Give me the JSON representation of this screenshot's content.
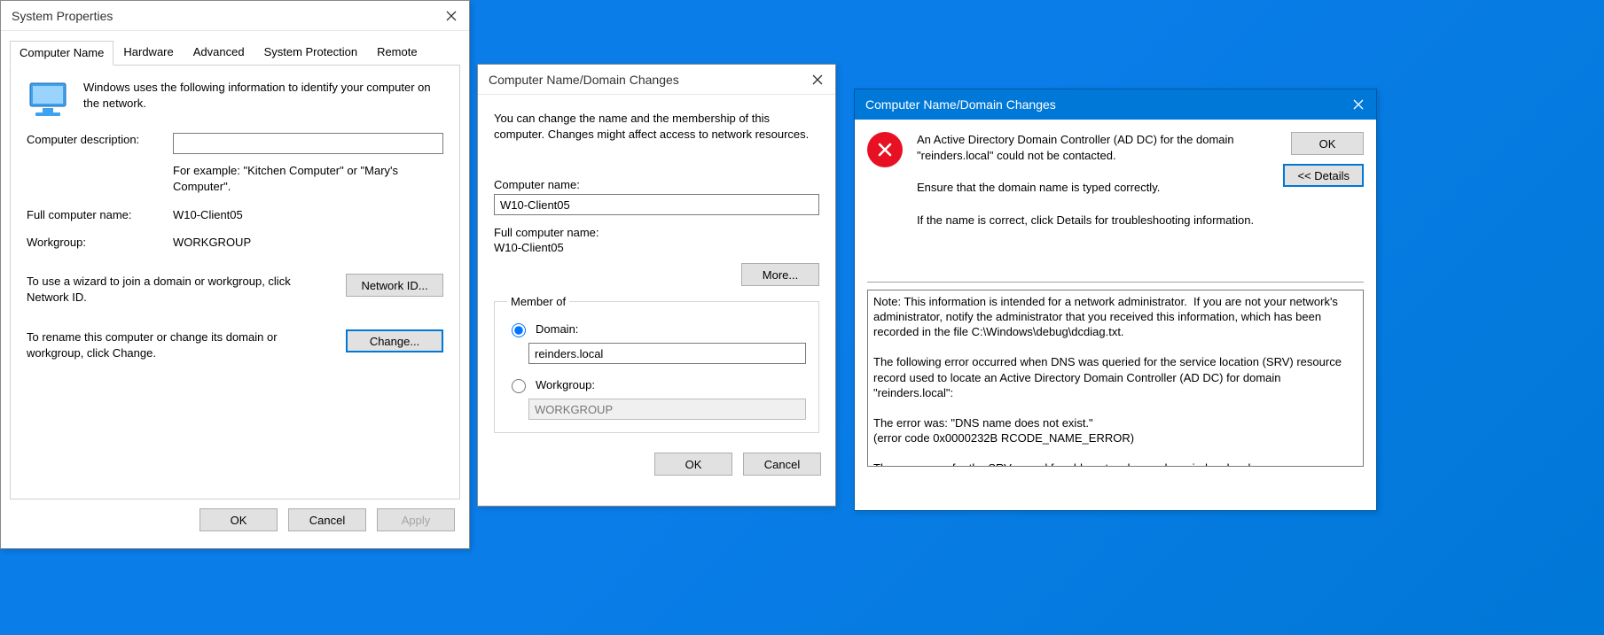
{
  "sysprops": {
    "title": "System Properties",
    "tabs": [
      "Computer Name",
      "Hardware",
      "Advanced",
      "System Protection",
      "Remote"
    ],
    "active_tab": 0,
    "intro": "Windows uses the following information to identify your computer on the network.",
    "desc_label": "Computer description:",
    "desc_value": "",
    "desc_example": "For example: \"Kitchen Computer\" or \"Mary's Computer\".",
    "full_name_label": "Full computer name:",
    "full_name_value": "W10-Client05",
    "workgroup_label": "Workgroup:",
    "workgroup_value": "WORKGROUP",
    "wizard_text": "To use a wizard to join a domain or workgroup, click Network ID.",
    "network_id_btn": "Network ID...",
    "change_text": "To rename this computer or change its domain or workgroup, click Change.",
    "change_btn": "Change...",
    "ok_btn": "OK",
    "cancel_btn": "Cancel",
    "apply_btn": "Apply"
  },
  "cnchanges": {
    "title": "Computer Name/Domain Changes",
    "intro": "You can change the name and the membership of this computer. Changes might affect access to network resources.",
    "computer_name_label": "Computer name:",
    "computer_name_value": "W10-Client05",
    "full_name_label": "Full computer name:",
    "full_name_value": "W10-Client05",
    "more_btn": "More...",
    "member_of_label": "Member of",
    "domain_label": "Domain:",
    "domain_value": "reinders.local",
    "workgroup_label": "Workgroup:",
    "workgroup_value": "WORKGROUP",
    "selected": "domain",
    "ok_btn": "OK",
    "cancel_btn": "Cancel"
  },
  "errdlg": {
    "title": "Computer Name/Domain Changes",
    "line1": "An Active Directory Domain Controller (AD DC) for the domain \"reinders.local\" could not be contacted.",
    "line2": "Ensure that the domain name is typed correctly.",
    "line3": "If the name is correct, click Details for troubleshooting information.",
    "ok_btn": "OK",
    "details_btn": "<< Details",
    "details_text": "Note: This information is intended for a network administrator.  If you are not your network's administrator, notify the administrator that you received this information, which has been recorded in the file C:\\Windows\\debug\\dcdiag.txt.\n\nThe following error occurred when DNS was queried for the service location (SRV) resource record used to locate an Active Directory Domain Controller (AD DC) for domain \"reinders.local\":\n\nThe error was: \"DNS name does not exist.\"\n(error code 0x0000232B RCODE_NAME_ERROR)\n\nThe query was for the SRV record for _ldap._tcp.dc._msdcs.reinders.local"
  }
}
